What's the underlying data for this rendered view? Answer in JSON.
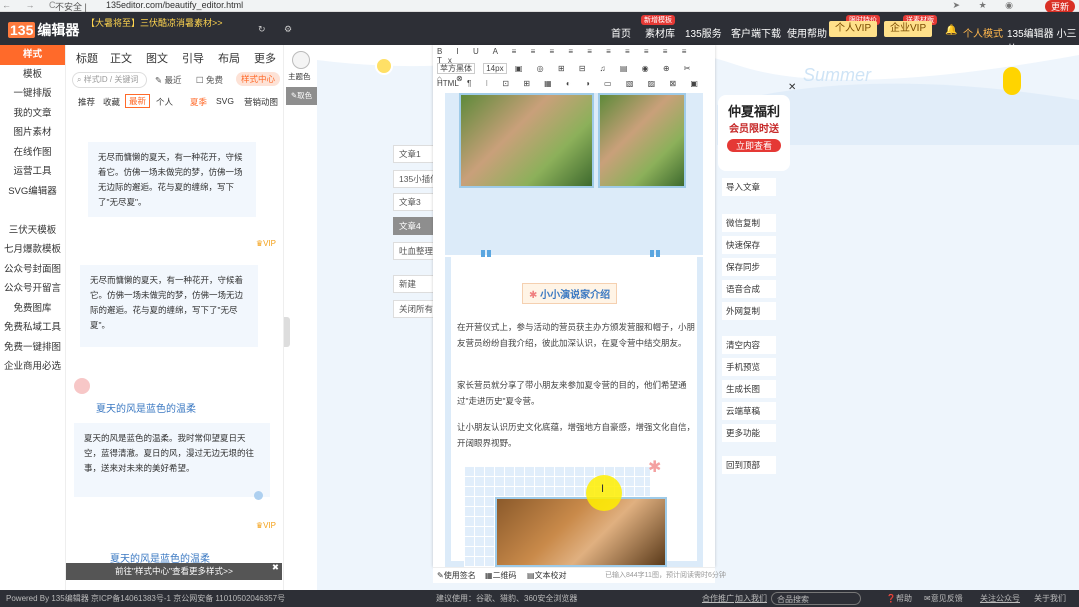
{
  "browser": {
    "nav": "← → C",
    "security": "不安全 |",
    "url": "135editor.com/beautify_editor.html",
    "update": "更新"
  },
  "header": {
    "logo_num": "135",
    "logo_text": "编辑器",
    "banner": "【大暑将至】三伏酷凉消暑素材>>",
    "menu": [
      "首页",
      "素材库",
      "135服务",
      "客户端下载",
      "使用帮助"
    ],
    "menu_badge": "新增模板",
    "vip_personal": "个人VIP",
    "vip_personal_badge": "限时特价",
    "vip_enterprise": "企业VIP",
    "vip_enterprise_badge": "送素材版",
    "mode": "个人模式",
    "user": "135编辑器 小三儿"
  },
  "leftnav": {
    "items": [
      "样式",
      "模板",
      "一键排版",
      "我的文章",
      "图片素材",
      "在线作图",
      "运营工具",
      "SVG编辑器",
      "",
      "三伏天模板",
      "七月爆款模板",
      "公众号封面图",
      "公众号开留言",
      "免费图库",
      "免费私域工具",
      "免费一键排图",
      "企业商用必选"
    ]
  },
  "panel": {
    "tabs": [
      "标题",
      "正文",
      "图文",
      "引导",
      "布局",
      "更多"
    ],
    "search_placeholder": "样式ID / 关键词",
    "chips": [
      "最近",
      "免费",
      "样式中心"
    ],
    "subtabs": [
      "推荐",
      "收藏",
      "最新",
      "个人",
      "夏季",
      "SVG",
      "营销动图"
    ],
    "card1": "无尽而慵懒的夏天，有一种花开，守候着它。仿佛一场未做完的梦，仿佛一场无边际的邂逅。花与夏的缠绵，写下了\"无尽夏\"。",
    "vip": "VIP",
    "card2": "无尽而慵懒的夏天，有一种花开，守候着它。仿佛一场未做完的梦，仿佛一场无边际的邂逅。花与夏的缠绵，写下了\"无尽夏\"。",
    "title3": "夏天的风是蓝色的温柔",
    "card3": "夏天的风是蓝色的温柔。我时常仰望夏日天空，蓝得清澈。夏日的风，漫过无边无垠的往事，送来对未来的美好希望。",
    "vip2": "VIP",
    "title4": "夏天的风是蓝色的温柔",
    "footer": "前往\"样式中心\"查看更多样式>>"
  },
  "sidetools": {
    "theme": "主题色",
    "pick": "取色"
  },
  "articles": [
    "文章1",
    "135小插件",
    "文章3",
    "文章4",
    "吐血整理",
    "新建",
    "关闭所有"
  ],
  "editor": {
    "font": "苹方黑体",
    "size": "14px",
    "html": "HTML",
    "toolbar1": "B I U A ≡ ≡ ≡ ≡ ≡ ≡ ≡ ≡ ≡ ≡ Tx",
    "toolbar2": "▣ ◎ ⊞ ⊟ ♫ ▤ ◉ ⊕ ✂ ⌂ ⊗",
    "toolbar3": "¶ ⁝ ⊡ ⊞ ▦ ◐ ◑ ▭ ▧ ▨ ⊠ ▣",
    "section_title": "小小演说家介绍",
    "p1": "在开营仪式上，参与活动的营员获主办方颁发营服和帽子，小朋友营员纷纷自我介绍，彼此加深认识，在夏令营中结交朋友。",
    "p2": "家长营员就分享了带小朋友来参加夏令营的目的，他们希望通过\"走进历史\"夏令营。",
    "p3": "让小朋友认识历史文化底蕴，增强地方自豪感，增强文化自信，开阔眼界视野。",
    "bottom": [
      "使用签名",
      "二维码",
      "文本校对"
    ],
    "status": "已输入844字11图，预计阅读需时6分钟"
  },
  "promo": {
    "line1": "仲夏福利",
    "line2": "会员限时送",
    "btn": "立即查看",
    "summer": "Summer"
  },
  "righttools": [
    "导入文章",
    "微信复制",
    "快速保存",
    "保存同步",
    "语音合成",
    "外网复制",
    "清空内容",
    "手机预览",
    "生成长图",
    "云端草稿",
    "更多功能",
    "回到顶部"
  ],
  "bottombar": {
    "left": "Powered By 135编辑器 京ICP备14061383号-1 京公网安备 11010502046357号",
    "mid": "建议使用：谷歌、猎豹、360安全浏览器",
    "links": [
      "合作推广",
      "加入我们"
    ],
    "search": "合品搜索",
    "help": "帮助",
    "feedback": "意见反馈",
    "follow": "关注公众号",
    "about": "关于我们"
  }
}
